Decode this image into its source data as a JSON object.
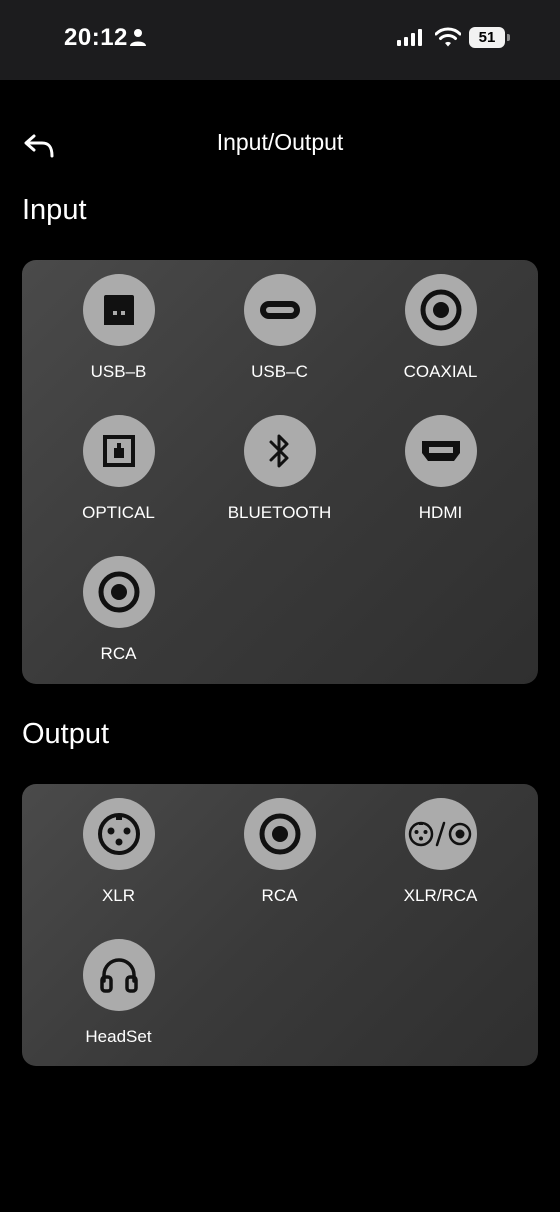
{
  "status": {
    "time": "20:12",
    "battery": "51"
  },
  "header": {
    "title": "Input/Output"
  },
  "input": {
    "title": "Input",
    "items": [
      {
        "label": "USB–B",
        "icon": "usb-b-icon"
      },
      {
        "label": "USB–C",
        "icon": "usb-c-icon"
      },
      {
        "label": "COAXIAL",
        "icon": "coaxial-icon"
      },
      {
        "label": "OPTICAL",
        "icon": "optical-icon"
      },
      {
        "label": "BLUETOOTH",
        "icon": "bluetooth-icon"
      },
      {
        "label": "HDMI",
        "icon": "hdmi-icon"
      },
      {
        "label": "RCA",
        "icon": "rca-icon"
      }
    ]
  },
  "output": {
    "title": "Output",
    "items": [
      {
        "label": "XLR",
        "icon": "xlr-icon"
      },
      {
        "label": "RCA",
        "icon": "rca-icon"
      },
      {
        "label": "XLR/RCA",
        "icon": "xlr-rca-icon"
      },
      {
        "label": "HeadSet",
        "icon": "headset-icon"
      }
    ]
  },
  "colors": {
    "background": "#000000",
    "panel": "#3c3c3c",
    "icon_circle": "#ababab",
    "icon_glyph": "#111111"
  }
}
